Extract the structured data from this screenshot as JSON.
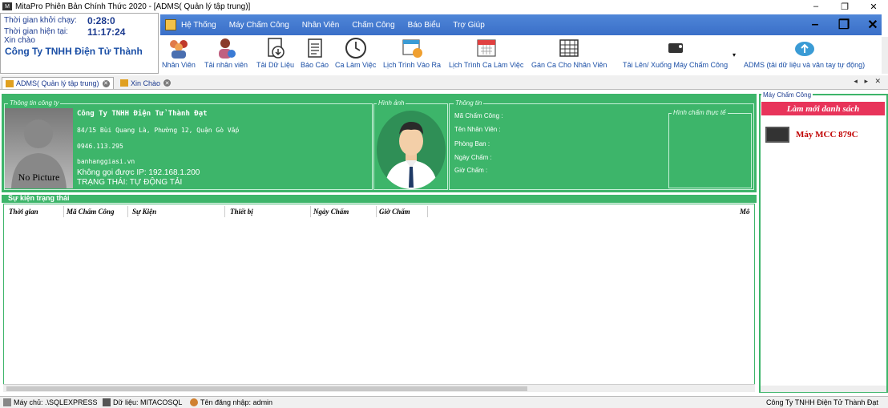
{
  "window": {
    "title": "MitaPro Phiên Bản Chính Thức 2020 - [ADMS( Quản lý tập trung)]",
    "minimize": "–",
    "restore": "❐",
    "close": "✕"
  },
  "info": {
    "start_label": "Thời gian khởi chạy:",
    "start_value": "0:28:0",
    "now_label": "Thời gian hiện tại:",
    "now_value": "11:17:24",
    "greeting": "Xin chào",
    "company": "Công Ty TNHH Điện Tử Thành"
  },
  "menu": {
    "items": [
      "Hệ Thống",
      "Máy Chấm Công",
      "Nhân Viên",
      "Chấm Công",
      "Báo Biểu",
      "Trợ Giúp"
    ]
  },
  "mdi": {
    "minimize": "–",
    "restore": "❐",
    "close": "✕"
  },
  "toolbar": {
    "items": [
      {
        "label": "Nhân Viên",
        "icon": "employees-icon"
      },
      {
        "label": "Tải nhân viên",
        "icon": "download-employee-icon"
      },
      {
        "label": "Tải Dữ Liệu",
        "icon": "download-data-icon"
      },
      {
        "label": "Báo Cáo",
        "icon": "report-icon"
      },
      {
        "label": "Ca Làm Việc",
        "icon": "clock-icon"
      },
      {
        "label": "Lịch Trình Vào Ra",
        "icon": "schedule-icon"
      },
      {
        "label": "Lịch Trình Ca Làm Việc",
        "icon": "calendar-icon"
      },
      {
        "label": "Gán Ca Cho Nhân Viên",
        "icon": "assign-shift-icon"
      },
      {
        "label": "Tải Lên/ Xuống Máy Chấm Công",
        "icon": "device-sync-icon"
      },
      {
        "label": "ADMS (tải dữ liệu và vân tay tự động)",
        "icon": "cloud-upload-icon"
      }
    ]
  },
  "tabs": [
    {
      "label": "ADMS( Quản lý tập trung)"
    },
    {
      "label": "Xin Chào"
    }
  ],
  "tabnav": "◂ ▸ ✕",
  "company_panel": {
    "section_label": "Thông tin công ty",
    "nopicture": "No Picture",
    "name": "Công Ty TNHH Điện Tử Thành Đạt",
    "address": "84/15 Bùi Quang Là, Phường 12, Quận Gò Vấp",
    "phone": "0946.113.295",
    "website": "banhanggiasi.vn",
    "ip": "Không gọi được IP: 192.168.1.200",
    "status": "TRẠNG THÁI: TỰ ĐỘNG TẢI"
  },
  "image_panel": {
    "label": "Hình ảnh"
  },
  "detail_panel": {
    "label": "Thông tin",
    "fields": [
      "Mã Chấm Công :",
      "Tên Nhân Viên :",
      "Phòng Ban :",
      "Ngày Chấm :",
      "Giờ Chấm :"
    ],
    "realtime_label": "Hình chấm thực tế"
  },
  "events": {
    "title": "Sự kiện trạng thái",
    "columns": [
      "Thời gian",
      "Mã Chấm Công",
      "Sự Kiện",
      "Thiết bị",
      "Ngày Chấm",
      "Giờ Chấm",
      "Mô"
    ]
  },
  "devices": {
    "label": "Máy Chấm Công",
    "refresh": "Làm mới danh sách",
    "items": [
      {
        "name": "Máy MCC 879C"
      }
    ]
  },
  "status": {
    "server": "Máy chủ: .\\SQLEXPRESS",
    "db": "Dữ liệu: MITACOSQL",
    "user": "Tên đăng nhập: admin",
    "company": "Công Ty TNHH Điện Tử Thành Đạt"
  }
}
